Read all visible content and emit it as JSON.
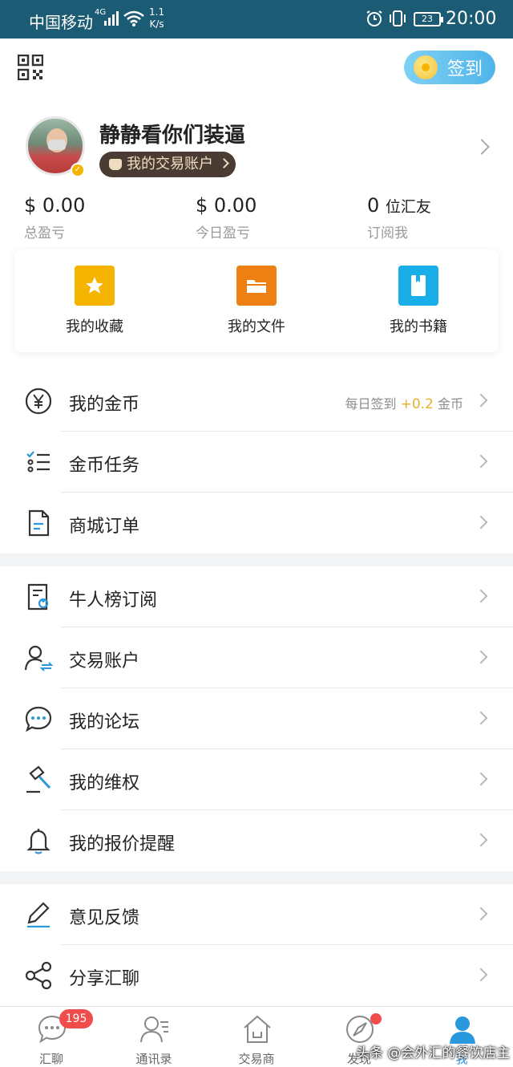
{
  "status_bar": {
    "carrier": "中国移动",
    "network": "4G",
    "speed_value": "1.1",
    "speed_unit": "K/s",
    "battery": "23",
    "time": "20:00"
  },
  "header": {
    "checkin_label": "签到",
    "username": "静静看你们装逼",
    "account_label": "我的交易账户",
    "stats": [
      {
        "value": "$ 0.00",
        "label": "总盈亏"
      },
      {
        "value": "$ 0.00",
        "label": "今日盈亏"
      },
      {
        "value": "0",
        "unit": "位汇友",
        "label": "订阅我"
      }
    ],
    "shortcuts": [
      {
        "label": "我的收藏",
        "icon": "star-icon",
        "color": "#f5b400"
      },
      {
        "label": "我的文件",
        "icon": "folder-icon",
        "color": "#ee7f12"
      },
      {
        "label": "我的书籍",
        "icon": "book-icon",
        "color": "#1aaee8"
      }
    ]
  },
  "menu": {
    "group1": [
      {
        "label": "我的金币",
        "icon": "yen-coin-icon",
        "extra_prefix": "每日签到",
        "extra_value": "+0.2",
        "extra_suffix": "金币"
      },
      {
        "label": "金币任务",
        "icon": "task-list-icon"
      },
      {
        "label": "商城订单",
        "icon": "document-icon"
      }
    ],
    "group2": [
      {
        "label": "牛人榜订阅",
        "icon": "subscription-icon"
      },
      {
        "label": "交易账户",
        "icon": "user-exchange-icon"
      },
      {
        "label": "我的论坛",
        "icon": "chat-bubble-icon"
      },
      {
        "label": "我的维权",
        "icon": "gavel-icon"
      },
      {
        "label": "我的报价提醒",
        "icon": "bell-icon"
      }
    ],
    "group3": [
      {
        "label": "意见反馈",
        "icon": "pencil-icon"
      },
      {
        "label": "分享汇聊",
        "icon": "share-icon"
      }
    ]
  },
  "tabbar": {
    "tabs": [
      {
        "label": "汇聊",
        "icon": "chat-icon",
        "badge": "195"
      },
      {
        "label": "通讯录",
        "icon": "contacts-icon"
      },
      {
        "label": "交易商",
        "icon": "house-icon"
      },
      {
        "label": "发现",
        "icon": "compass-icon"
      },
      {
        "label": "我",
        "icon": "person-icon"
      }
    ],
    "active_index": 4
  },
  "watermark": "头条 @会外汇的餐饮店主",
  "colors": {
    "status_bar": "#1b5b73",
    "accent": "#2a98dc",
    "gold": "#e8b02a",
    "badge_red": "#f14c4c"
  }
}
